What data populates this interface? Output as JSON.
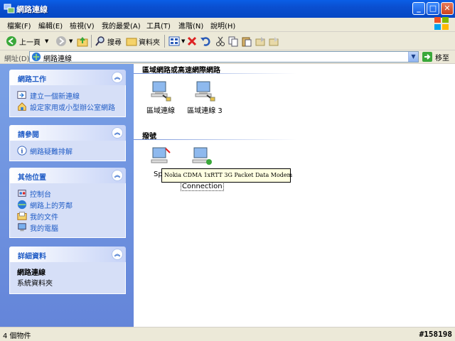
{
  "window": {
    "title": "網路連線",
    "controls": {
      "minimize": "_",
      "maximize": "□",
      "close": "✕"
    }
  },
  "menubar": {
    "items": [
      "檔案(F)",
      "編輯(E)",
      "檢視(V)",
      "我的最愛(A)",
      "工具(T)",
      "進階(N)",
      "說明(H)"
    ]
  },
  "toolbar": {
    "back_label": "上一頁",
    "search_label": "搜尋",
    "folders_label": "資料夾"
  },
  "address": {
    "label": "網址(D)",
    "value": "網路連線",
    "go_label": "移至"
  },
  "sidebar": {
    "network_tasks": {
      "title": "網路工作",
      "items": [
        "建立一個新連線",
        "設定家用或小型辦公室網路"
      ]
    },
    "see_also": {
      "title": "請參閱",
      "items": [
        "網路疑難排解"
      ]
    },
    "other_places": {
      "title": "其他位置",
      "items": [
        "控制台",
        "網路上的芳鄰",
        "我的文件",
        "我的電腦"
      ]
    },
    "details": {
      "title": "詳細資料",
      "name": "網路連線",
      "type": "系統資料夾"
    }
  },
  "content": {
    "lan_group": {
      "title": "區域網路或高速網際網路",
      "items": [
        "區域連線",
        "區域連線 3"
      ]
    },
    "modem_group": {
      "title": "撥號",
      "items": [
        "Sp",
        "Connection"
      ]
    },
    "tooltip": "Nokia CDMA 1xRTT 3G Packet Data Modem"
  },
  "status": {
    "text": "4 個物件",
    "watermark": "#158198"
  },
  "colors": {
    "title_bar": "#0a4fd0",
    "side_pane": "#6485d9",
    "link": "#215dc6",
    "chrome": "#ece9d8"
  }
}
